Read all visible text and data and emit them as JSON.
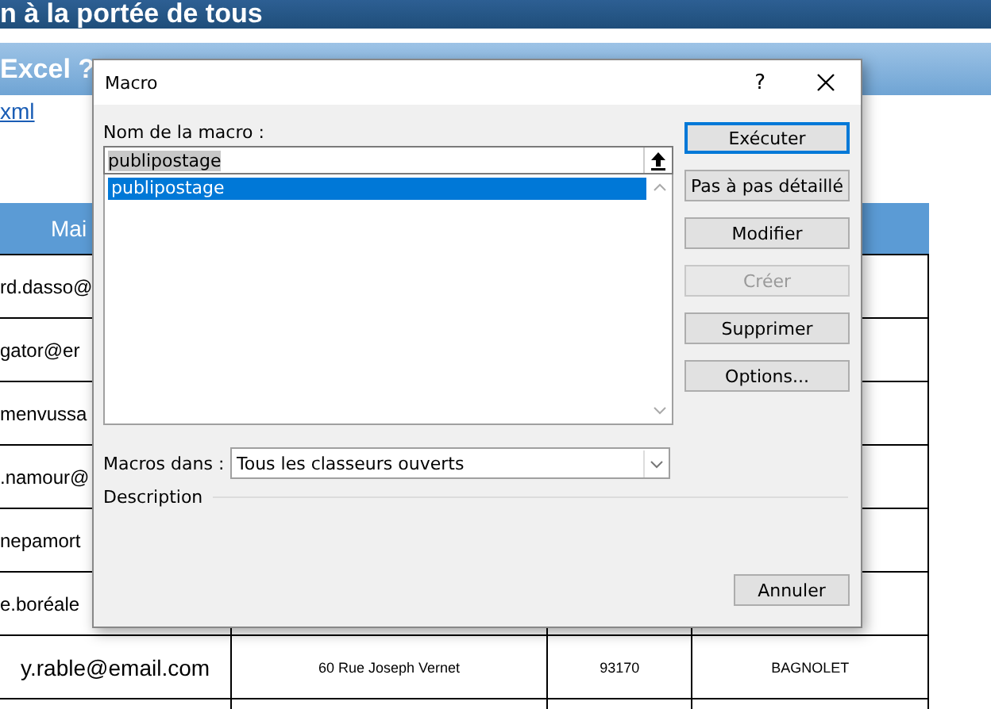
{
  "page": {
    "banner": "n à la portée de tous",
    "section_title": "Excel ?",
    "link": "xml",
    "table": {
      "columns": [
        "Mai"
      ],
      "rows": [
        {
          "kind": "covered",
          "cells": [
            "rd.dasso@"
          ]
        },
        {
          "kind": "covered",
          "cells": [
            "gator@er"
          ]
        },
        {
          "kind": "covered",
          "cells": [
            "menvussa"
          ]
        },
        {
          "kind": "covered",
          "cells": [
            ".namour@"
          ]
        },
        {
          "kind": "covered",
          "cells": [
            "nepamort"
          ]
        },
        {
          "kind": "covered",
          "cells": [
            "e.boréale"
          ]
        },
        {
          "kind": "full",
          "cells": [
            "y.rable@email.com",
            "60 Rue Joseph Vernet",
            "93170",
            "BAGNOLET"
          ]
        }
      ]
    }
  },
  "dialog": {
    "title": "Macro",
    "help": "?",
    "name_label": "Nom de la macro :",
    "name_field": {
      "value": "publipostage",
      "highlighted": true
    },
    "macros": [
      {
        "label": "publipostage",
        "selected": true
      }
    ],
    "buttons": [
      {
        "label": "Exécuter",
        "default": true,
        "disabled": false
      },
      {
        "label": "Pas à pas détaillé",
        "default": false,
        "disabled": false
      },
      {
        "label": "Modifier",
        "default": false,
        "disabled": false
      },
      {
        "label": "Créer",
        "default": false,
        "disabled": true
      },
      {
        "label": "Supprimer",
        "default": false,
        "disabled": false
      },
      {
        "label": "Options...",
        "default": false,
        "disabled": false
      }
    ],
    "macros_in_label": "Macros dans :",
    "macros_in_value": "Tous les classeurs ouverts",
    "description_label": "Description",
    "cancel": "Annuler"
  }
}
